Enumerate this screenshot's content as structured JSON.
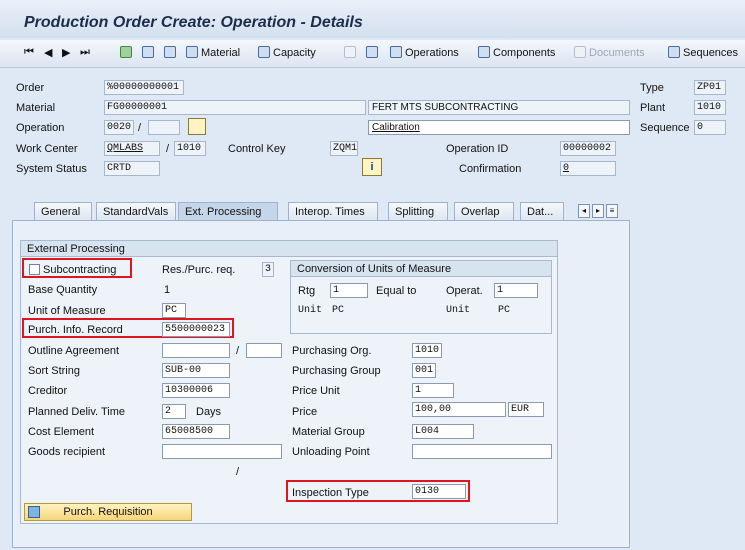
{
  "title": "Production Order Create: Operation - Details",
  "toolbar": {
    "nav": [
      "⏮",
      "◀",
      "▶",
      "⏭"
    ],
    "material": "Material",
    "capacity": "Capacity",
    "operations": "Operations",
    "components": "Components",
    "documents": "Documents",
    "sequences": "Sequences"
  },
  "header": {
    "order_label": "Order",
    "order_value": "%00000000001",
    "material_label": "Material",
    "material_value": "FG00000001",
    "material_desc": "FERT MTS SUBCONTRACTING",
    "operation_label": "Operation",
    "operation_value": "0020",
    "operation_sep": "/",
    "operation_desc": "Calibration",
    "workcenter_label": "Work Center",
    "workcenter_value": "QMLABS",
    "workcenter_sep": "/",
    "plant_value2": "1010",
    "controlkey_label": "Control Key",
    "controlkey_value": "ZQM1",
    "opid_label": "Operation ID",
    "opid_value": "00000002",
    "status_label": "System Status",
    "status_value": "CRTD",
    "confirmation_label": "Confirmation",
    "confirmation_value": "0",
    "type_label": "Type",
    "type_value": "ZP01",
    "plant_label": "Plant",
    "plant_value": "1010",
    "sequence_label": "Sequence",
    "sequence_value": "0"
  },
  "tabs": [
    "General",
    "StandardVals",
    "Ext. Processing",
    "Interop. Times",
    "Splitting",
    "Overlap",
    "Dat..."
  ],
  "ext": {
    "group_title": "External Processing",
    "subcontracting": "Subcontracting",
    "respurc_label": "Res./Purc. req.",
    "respurc_value": "3",
    "basequantity_label": "Base Quantity",
    "basequantity_value": "1",
    "uom_label": "Unit of Measure",
    "uom_value": "PC",
    "pir_label": "Purch. Info. Record",
    "pir_value": "5500000023",
    "outline_label": "Outline Agreement",
    "outline_sep": "/",
    "sortstring_label": "Sort String",
    "sortstring_value": "SUB-00",
    "creditor_label": "Creditor",
    "creditor_value": "10300006",
    "planned_label": "Planned Deliv. Time",
    "planned_value": "2",
    "planned_unit": "Days",
    "costelement_label": "Cost Element",
    "costelement_value": "65008500",
    "goods_label": "Goods recipient",
    "slash": "/",
    "conversion_title": "Conversion of Units of Measure",
    "rtg_label": "Rtg",
    "rtg_value": "1",
    "equal_to": "Equal to",
    "operat_label": "Operat.",
    "operat_value": "1",
    "unit_label1": "Unit",
    "unit_value1": "PC",
    "unit_label2": "Unit",
    "unit_value2": "PC",
    "purchorg_label": "Purchasing Org.",
    "purchorg_value": "1010",
    "purchgroup_label": "Purchasing Group",
    "purchgroup_value": "001",
    "priceunit_label": "Price Unit",
    "priceunit_value": "1",
    "price_label": "Price",
    "price_value": "100,00",
    "currency": "EUR",
    "matgroup_label": "Material Group",
    "matgroup_value": "L004",
    "unloading_label": "Unloading Point",
    "inspection_label": "Inspection Type",
    "inspection_value": "0130",
    "purch_req_button": "Purch. Requisition"
  },
  "colors": {
    "highlight": "#e0141e",
    "background": "#dfe9f5",
    "button": "#f5d57a"
  }
}
